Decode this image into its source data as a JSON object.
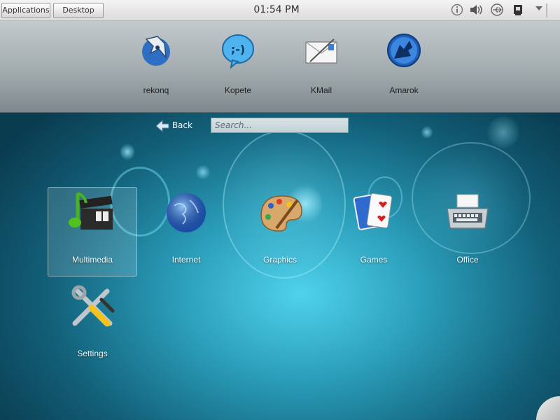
{
  "panel": {
    "applications_label": "Applications",
    "desktop_label": "Desktop",
    "clock": "01:54 PM"
  },
  "favorites": [
    {
      "label": "rekonq",
      "icon": "rekonq-icon"
    },
    {
      "label": "Kopete",
      "icon": "kopete-icon"
    },
    {
      "label": "KMail",
      "icon": "kmail-icon"
    },
    {
      "label": "Amarok",
      "icon": "amarok-icon"
    }
  ],
  "nav": {
    "back_label": "Back",
    "search_placeholder": "Search..."
  },
  "categories": [
    {
      "label": "Multimedia",
      "icon": "multimedia-icon",
      "selected": true
    },
    {
      "label": "Internet",
      "icon": "internet-icon"
    },
    {
      "label": "Graphics",
      "icon": "graphics-icon"
    },
    {
      "label": "Games",
      "icon": "games-icon"
    },
    {
      "label": "Office",
      "icon": "office-icon"
    },
    {
      "label": "Settings",
      "icon": "settings-icon"
    }
  ],
  "colors": {
    "background": "#2a9cb8",
    "accent": "#4fd2ec"
  }
}
